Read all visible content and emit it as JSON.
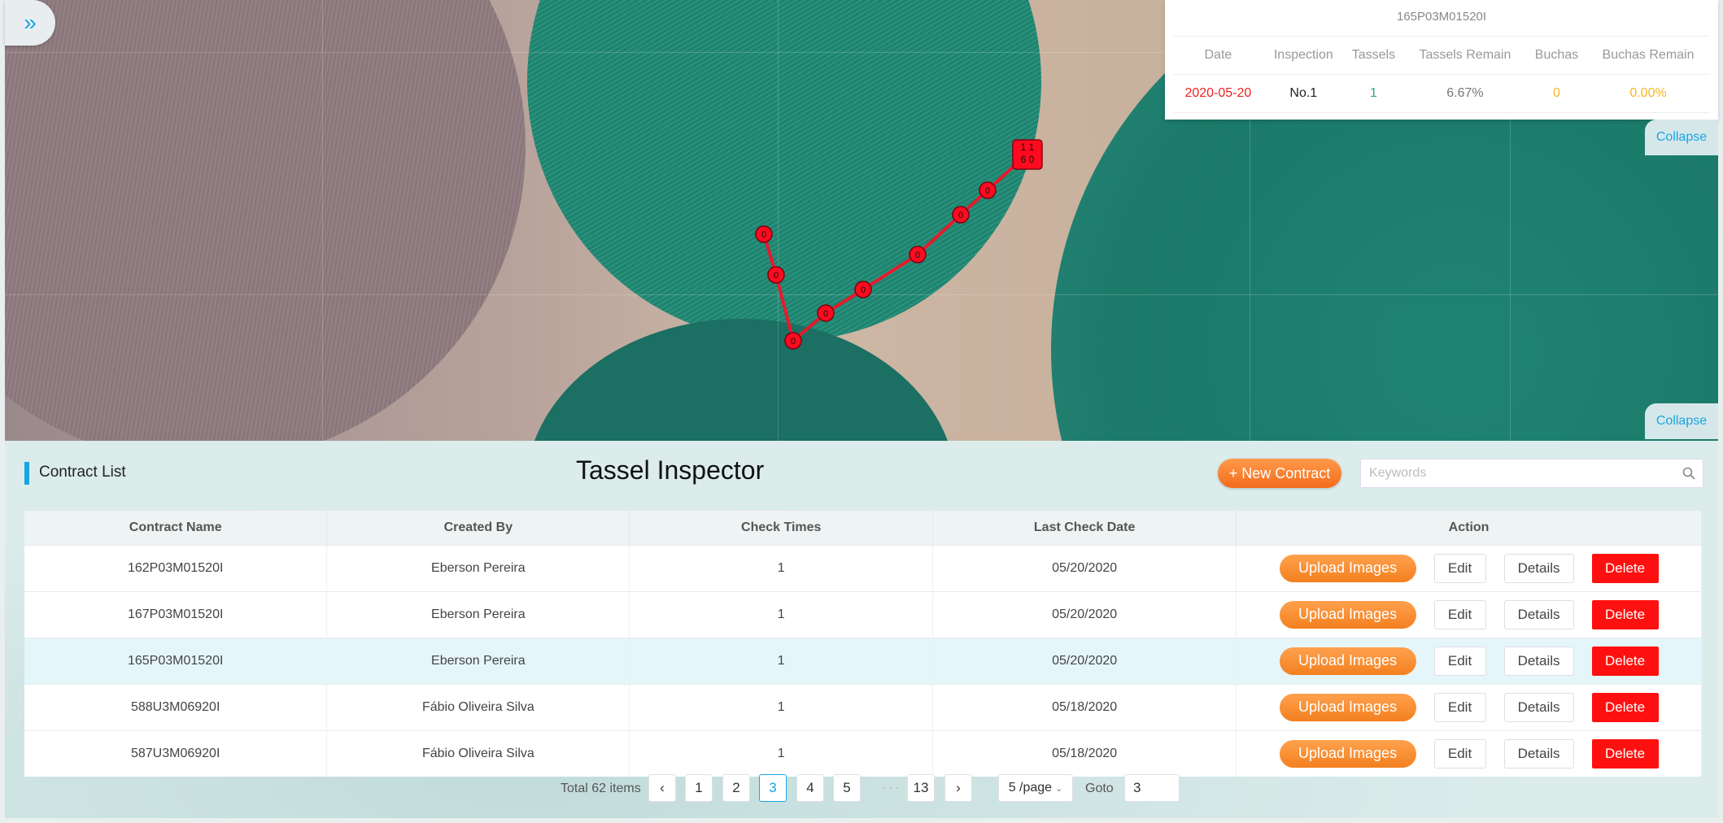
{
  "sidebar": {
    "expand_icon": "»"
  },
  "map": {
    "track_points": [
      {
        "label": "0"
      },
      {
        "label": "0"
      },
      {
        "label": "0"
      },
      {
        "label": "0"
      },
      {
        "label": "0"
      },
      {
        "label": "0"
      },
      {
        "label": "0"
      },
      {
        "label": "0"
      },
      {
        "label": "0"
      }
    ],
    "end_marker": {
      "line1": "1 1",
      "line2": "6 0"
    }
  },
  "info_panel": {
    "title": "165P03M01520I",
    "headers": [
      "Date",
      "Inspection",
      "Tassels",
      "Tassels Remain",
      "Buchas",
      "Buchas Remain"
    ],
    "row": {
      "date": "2020-05-20",
      "inspection": "No.1",
      "tassels": "1",
      "tassels_remain": "6.67%",
      "buchas": "0",
      "buchas_remain": "0.00%"
    },
    "collapse_label": "Collapse"
  },
  "map_collapse_label": "Collapse",
  "header": {
    "list_title": "Contract List",
    "app_title": "Tassel Inspector",
    "new_contract_label": "+ New Contract",
    "search_placeholder": "Keywords"
  },
  "table": {
    "columns": [
      "Contract Name",
      "Created By",
      "Check Times",
      "Last Check Date",
      "Action"
    ],
    "rows": [
      {
        "name": "162P03M01520I",
        "created_by": "Eberson Pereira",
        "check_times": "1",
        "last_check": "05/20/2020"
      },
      {
        "name": "167P03M01520I",
        "created_by": "Eberson Pereira",
        "check_times": "1",
        "last_check": "05/20/2020"
      },
      {
        "name": "165P03M01520I",
        "created_by": "Eberson Pereira",
        "check_times": "1",
        "last_check": "05/20/2020"
      },
      {
        "name": "588U3M06920I",
        "created_by": "Fábio Oliveira Silva",
        "check_times": "1",
        "last_check": "05/18/2020"
      },
      {
        "name": "587U3M06920I",
        "created_by": "Fábio Oliveira Silva",
        "check_times": "1",
        "last_check": "05/18/2020"
      }
    ],
    "selected_row": 2,
    "actions": {
      "upload": "Upload Images",
      "edit": "Edit",
      "details": "Details",
      "delete": "Delete"
    }
  },
  "pagination": {
    "total_label": "Total 62 items",
    "prev": "‹",
    "pages": [
      "1",
      "2",
      "3",
      "4",
      "5"
    ],
    "current": "3",
    "ellipsis": "···",
    "last_page": "13",
    "next": "›",
    "page_size": "5 /page",
    "goto_label": "Goto",
    "goto_value": "3"
  },
  "colors": {
    "accent": "#1aa5e0",
    "orange": "#f3801f",
    "danger": "#ff1010",
    "track": "#e8192c"
  }
}
